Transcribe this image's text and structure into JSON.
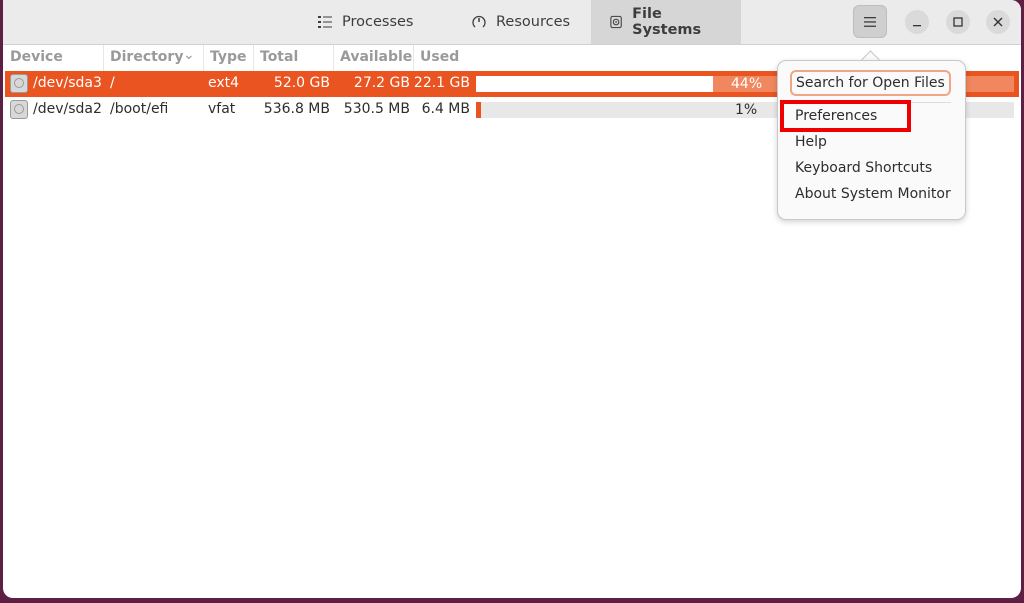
{
  "window": {
    "tabs": [
      {
        "label": "Processes",
        "icon": "list-icon",
        "active": false
      },
      {
        "label": "Resources",
        "icon": "gauge-icon",
        "active": false
      },
      {
        "label": "File Systems",
        "icon": "disk-icon",
        "active": true
      }
    ],
    "controls": {
      "menu": "hamburger-menu-icon",
      "minimize": "_",
      "maximize": "□",
      "close": "✕"
    }
  },
  "table": {
    "columns": [
      "Device",
      "Directory",
      "Type",
      "Total",
      "Available",
      "Used"
    ],
    "sort_indicator": "⌄",
    "rows": [
      {
        "device": "/dev/sda3",
        "directory": "/",
        "type": "ext4",
        "total": "52.0 GB",
        "available": "27.2 GB",
        "used": "22.1 GB",
        "percent_label": "44%",
        "percent": 44,
        "selected": true
      },
      {
        "device": "/dev/sda2",
        "directory": "/boot/efi",
        "type": "vfat",
        "total": "536.8 MB",
        "available": "530.5 MB",
        "used": "6.4 MB",
        "percent_label": "1%",
        "percent": 1,
        "selected": false
      }
    ]
  },
  "menu": {
    "search_label": "Search for Open Files",
    "items": [
      "Preferences",
      "Help",
      "Keyboard Shortcuts",
      "About System Monitor"
    ],
    "highlighted_item": "Preferences"
  },
  "colors": {
    "accent": "#e95420",
    "highlight_box": "#ee0000",
    "desktop": "#5e1f44"
  }
}
